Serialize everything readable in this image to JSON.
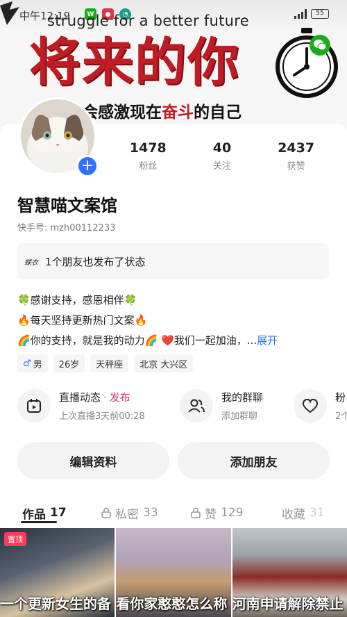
{
  "status_bar": {
    "time": "中午12:19",
    "notification_icons": [
      "wechat-icon",
      "app-red-icon",
      "app-teal-icon"
    ],
    "battery": "55"
  },
  "banner": {
    "caption": "struggle for a better future",
    "title": "将来的你",
    "subtitle_prefix": "会感激现在",
    "subtitle_highlight": "奋斗",
    "subtitle_suffix": "的自己"
  },
  "profile": {
    "stats": [
      {
        "value": "1478",
        "label": "粉丝"
      },
      {
        "value": "40",
        "label": "关注"
      },
      {
        "value": "2437",
        "label": "获赞"
      }
    ],
    "username": "智慧喵文案馆",
    "kuaishou_id": "快手号: mzh00112233",
    "friends_badge": "蝶衣",
    "friends_text": "1个朋友也发布了状态",
    "bio": [
      "🍀感谢支持，感恩相伴🍀",
      "🔥每天坚持更新热门文案🔥",
      "🌈你的支持，就是我的动力🌈 ❤️我们一起加油，..."
    ],
    "bio_more": "展开",
    "tags": {
      "gender_symbol": "♂",
      "gender": "男",
      "age": "26岁",
      "zodiac": "天秤座",
      "location": "北京 大兴区"
    }
  },
  "quick_actions": [
    {
      "title": "直播动态",
      "action": "发布",
      "subtitle": "上次直播3天前00:28"
    },
    {
      "title": "我的群聊",
      "subtitle": "添加群聊"
    },
    {
      "title": "粉",
      "subtitle": "2个"
    }
  ],
  "buttons": {
    "edit_profile": "编辑资料",
    "add_friend": "添加朋友"
  },
  "tabs": [
    {
      "label": "作品",
      "count": "17"
    },
    {
      "label": "私密",
      "count": "33"
    },
    {
      "label": "赞",
      "count": "129"
    },
    {
      "label": "收藏",
      "count": "31"
    }
  ],
  "works": {
    "pin_label": "置顶",
    "captions": [
      "一个更新女生的备",
      "看你家憨憨怎么称",
      "河南申请解除禁止"
    ]
  },
  "colors": {
    "accent_blue": "#2f73ff",
    "publish_pink": "#e0306a",
    "banner_red": "#c01c24",
    "pin_red": "#ff3b5c"
  }
}
